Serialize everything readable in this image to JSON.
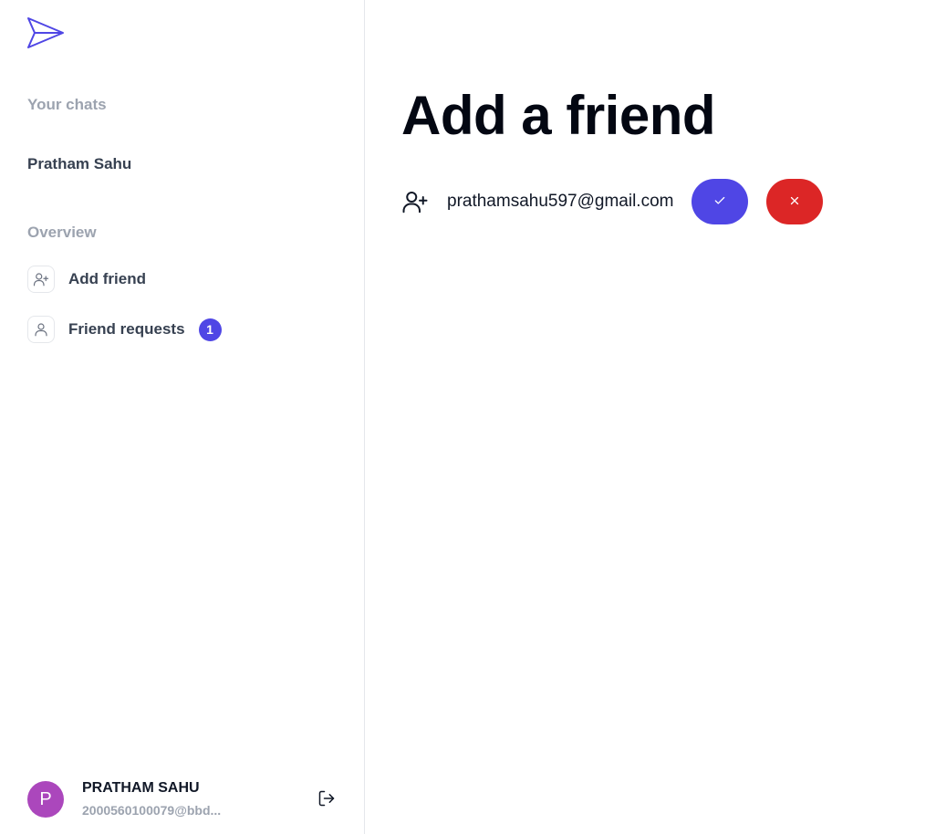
{
  "sidebar": {
    "logo_icon": "paper-plane-icon",
    "chats_heading": "Your chats",
    "chats": [
      {
        "name": "Pratham Sahu"
      }
    ],
    "overview_heading": "Overview",
    "nav": [
      {
        "label": "Add friend",
        "icon": "user-plus-icon"
      },
      {
        "label": "Friend requests",
        "icon": "user-icon",
        "badge": "1"
      }
    ],
    "profile": {
      "avatar_letter": "P",
      "name": "PRATHAM SAHU",
      "email": "2000560100079@bbd...",
      "logout_icon": "logout-icon"
    }
  },
  "main": {
    "title": "Add a friend",
    "requests": [
      {
        "email": "prathamsahu597@gmail.com",
        "icon": "user-plus-icon"
      }
    ]
  },
  "colors": {
    "accent": "#4f46e5",
    "danger": "#dc2626",
    "avatar": "#ab47bc",
    "muted": "#9ca3af"
  }
}
